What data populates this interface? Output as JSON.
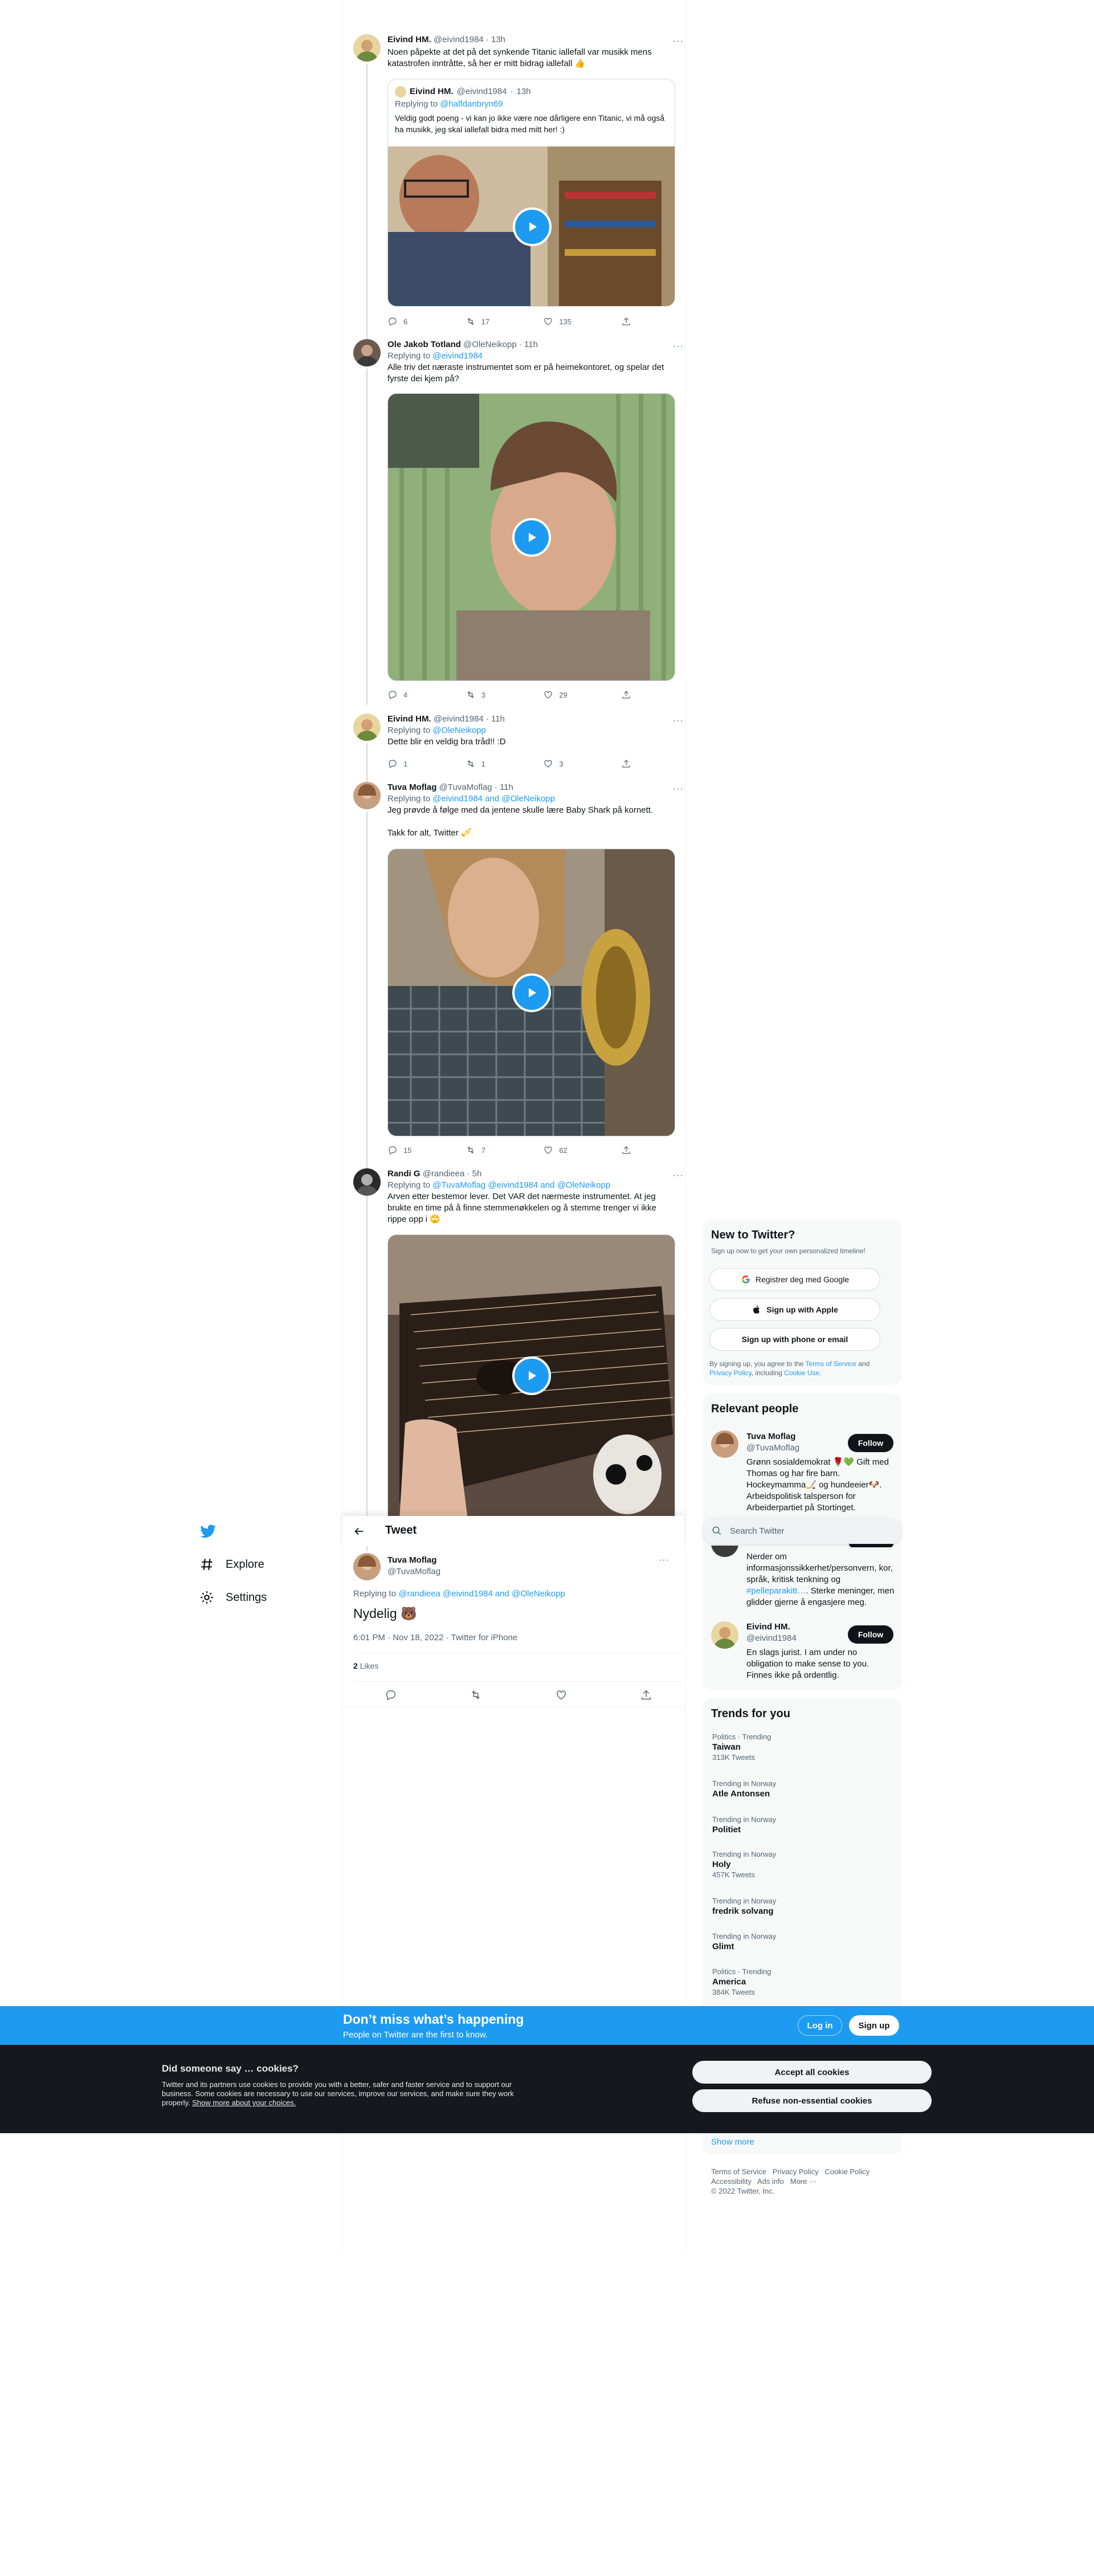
{
  "colors": {
    "accent": "#1d9bf0",
    "text": "#0f1419",
    "muted": "#536471",
    "cookie_bg": "#15181c"
  },
  "nav": {
    "logo_icon": "twitter-bird-icon",
    "items": [
      {
        "label": "Explore",
        "icon": "hashtag-icon"
      },
      {
        "label": "Settings",
        "icon": "gear-icon"
      }
    ]
  },
  "thread": [
    {
      "name": "Eivind HM.",
      "handle": "@eivind1984",
      "time": "13h",
      "text": "Noen påpekte at det på det synkende Titanic iallefall var musikk mens katastrofen inntråtte, så her er mitt bidrag iallefall 👍",
      "quote": {
        "name": "Eivind HM.",
        "handle": "@eivind1984",
        "time": "13h",
        "replying_prefix": "Replying to",
        "replying_to": "@halfdanbryn69",
        "text": "Veldig godt poeng - vi kan jo ikke være noe dårligere enn Titanic, vi må også ha musikk, jeg skal iallefall bidra med mitt her! :)"
      },
      "stats": {
        "replies": "6",
        "retweets": "17",
        "likes": "135"
      }
    },
    {
      "name": "Ole Jakob Totland",
      "handle": "@OleNeikopp",
      "time": "11h",
      "replying_prefix": "Replying to",
      "replying_to": "@eivind1984",
      "text": "Alle triv det næraste instrumentet som er på heimekontoret, og spelar det fyrste dei kjem på?",
      "stats": {
        "replies": "4",
        "retweets": "3",
        "likes": "29"
      }
    },
    {
      "name": "Eivind HM.",
      "handle": "@eivind1984",
      "time": "11h",
      "replying_prefix": "Replying to",
      "replying_to": "@OleNeikopp",
      "text": "Dette blir en veldig bra tråd!! :D",
      "stats": {
        "replies": "1",
        "retweets": "1",
        "likes": "3"
      }
    },
    {
      "name": "Tuva Moflag",
      "handle": "@TuvaMoflag",
      "time": "11h",
      "replying_prefix": "Replying to",
      "replying_to": "@eivind1984 and @OleNeikopp",
      "text": "Jeg prøvde å følge med da jentene skulle lære Baby Shark på kornett.",
      "text2": "Takk for alt, Twitter 🎺",
      "stats": {
        "replies": "15",
        "retweets": "7",
        "likes": "62"
      }
    },
    {
      "name": "Randi G",
      "handle": "@randieea",
      "time": "5h",
      "replying_prefix": "Replying to",
      "replying_to": "@TuvaMoflag @eivind1984 and @OleNeikopp",
      "text": "Arven etter bestemor lever. Det VAR det nærmeste instrumentet. At jeg brukte en time på å finne stemmenøkkelen og å stemme trenger vi ikke rippe opp i 🙄"
    }
  ],
  "tweet_header": {
    "title": "Tweet"
  },
  "focused": {
    "name": "Tuva Moflag",
    "handle": "@TuvaMoflag",
    "replying_prefix": "Replying to",
    "replying_to": "@randieea @eivind1984 and @OleNeikopp",
    "text": "Nydelig 🐻",
    "meta": "6:01 PM · Nov 18, 2022 · Twitter for iPhone",
    "likes_count": "2",
    "likes_label": "Likes"
  },
  "signup": {
    "title": "New to Twitter?",
    "subtitle": "Sign up now to get your own personalized timeline!",
    "google": "Registrer deg med Google",
    "apple": "Sign up with Apple",
    "phone": "Sign up with phone or email",
    "legal_1": "By signing up, you agree to the",
    "legal_tos": "Terms of Service",
    "legal_and": "and",
    "legal_privacy": "Privacy Policy",
    "legal_2": ", including",
    "legal_cookie": "Cookie Use",
    "legal_end": "."
  },
  "search": {
    "placeholder": "Search Twitter"
  },
  "relevant": {
    "title": "Relevant people",
    "follow": "Follow",
    "people": [
      {
        "name": "Tuva Moflag",
        "handle": "@TuvaMoflag",
        "bio": "Grønn sosialdemokrat 🌹💚 Gift med Thomas og har fire barn. Hockeymamma🏒 og hundeeier🐶. Arbeidspolitisk talsperson for Arbeiderpartiet på Stortinget."
      },
      {
        "bio_pre": "Nerder om informasjonssikkerhet/personvern, kor, språk, kritisk tenkning og",
        "bio_link": "#pelleparakitt…",
        "bio_post": ". Sterke meninger, men glidder gjerne å engasjere meg."
      },
      {
        "name": "Eivind HM.",
        "handle": "@eivind1984",
        "bio": "En slags jurist. I am under no obligation to make sense to you. Finnes ikke på ordentlig."
      }
    ]
  },
  "trends": {
    "title": "Trends for you",
    "items": [
      {
        "context": "Politics · Trending",
        "name": "Taiwan",
        "count": "313K Tweets"
      },
      {
        "context": "Trending in Norway",
        "name": "Atle Antonsen",
        "count": ""
      },
      {
        "context": "Trending in Norway",
        "name": "Politiet",
        "count": ""
      },
      {
        "context": "Trending in Norway",
        "name": "Holy",
        "count": "457K Tweets"
      },
      {
        "context": "Trending in Norway",
        "name": "fredrik solvang",
        "count": ""
      },
      {
        "context": "Trending in Norway",
        "name": "Glimt",
        "count": ""
      },
      {
        "context": "Politics · Trending",
        "name": "America",
        "count": "384K Tweets"
      }
    ],
    "show_more": "Show more"
  },
  "footer": {
    "links_row1": [
      "Terms of Service",
      "Privacy Policy",
      "Cookie Policy"
    ],
    "links_row2": [
      "Accessibility",
      "Ads info",
      "More ···"
    ],
    "copyright": "© 2022 Twitter, Inc."
  },
  "banner": {
    "title": "Don’t miss what’s happening",
    "subtitle": "People on Twitter are the first to know.",
    "login": "Log in",
    "signup": "Sign up"
  },
  "cookie": {
    "title": "Did someone say … cookies?",
    "body": "Twitter and its partners use cookies to provide you with a better, safer and faster service and to support our business. Some cookies are necessary to use our services, improve our services, and make sure they work properly.",
    "link": "Show more about your choices.",
    "accept": "Accept all cookies",
    "refuse": "Refuse non-essential cookies"
  }
}
